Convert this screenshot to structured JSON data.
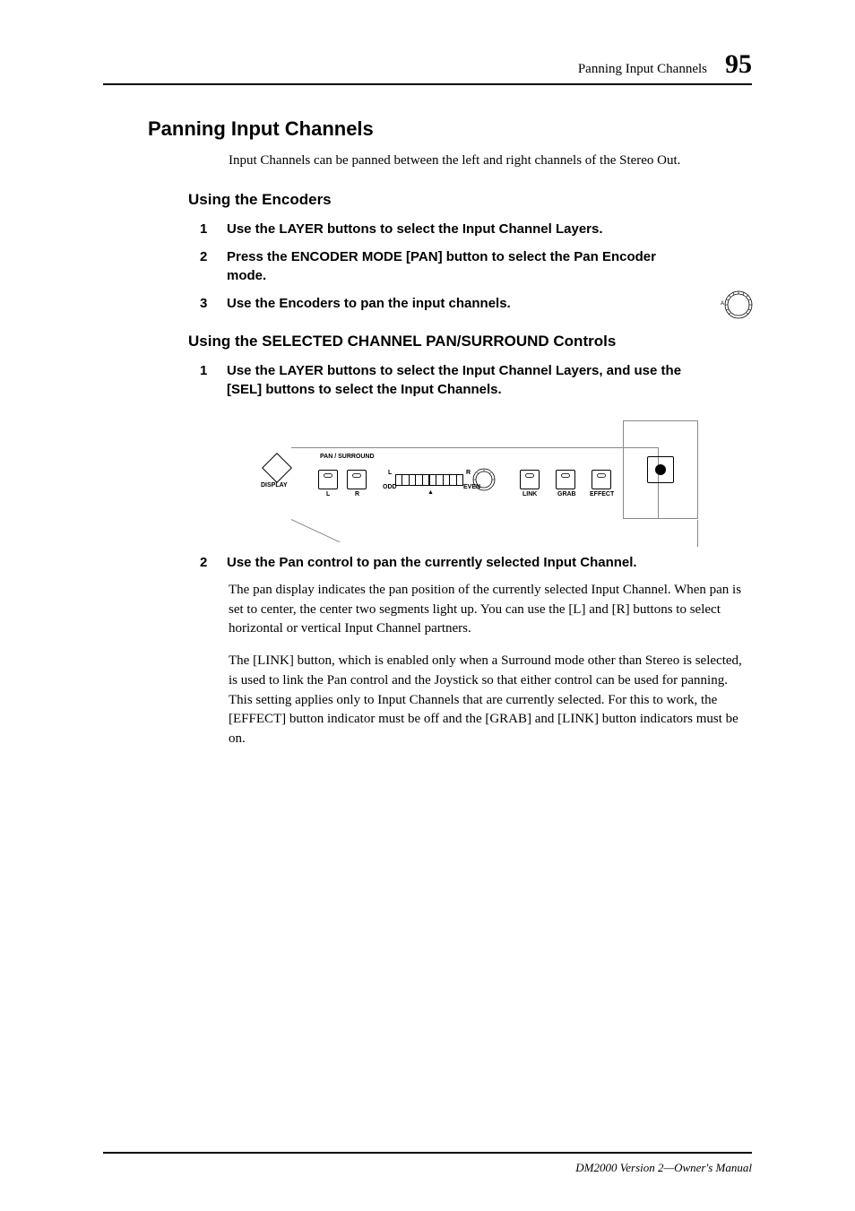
{
  "header": {
    "title": "Panning Input Channels",
    "page": "95"
  },
  "h1": "Panning Input Channels",
  "intro": "Input Channels can be panned between the left and right channels of the Stereo Out.",
  "section1": {
    "title": "Using the Encoders",
    "steps": [
      "Use the LAYER buttons to select the Input Channel Layers.",
      "Press the ENCODER MODE [PAN] button to select the Pan Encoder mode.",
      "Use the Encoders to pan the input channels."
    ]
  },
  "section2": {
    "title": "Using the SELECTED CHANNEL PAN/SURROUND Controls",
    "step1": "Use the LAYER buttons to select the Input Channel Layers, and use the [SEL] buttons to select the Input Channels.",
    "step2": "Use the Pan control to pan the currently selected Input Channel.",
    "body1": "The pan display indicates the pan position of the currently selected Input Channel. When pan is set to center, the center two segments light up. You can use the [L] and [R] buttons to select horizontal or vertical Input Channel partners.",
    "body2": "The [LINK] button, which is enabled only when a Surround mode other than Stereo is selected, is used to link the Pan control and the Joystick so that either control can be used for panning. This setting applies only to Input Channels that are currently selected. For this to work, the [EFFECT] button indicator must be off and the [GRAB] and [LINK] button indicators must be on."
  },
  "panel": {
    "title": "PAN / SURROUND",
    "display": "DISPLAY",
    "l": "L",
    "r": "R",
    "l_odd_label": "L",
    "odd": "ODD",
    "r_even_label": "R",
    "even": "EVEN",
    "arrows": "▲",
    "link": "LINK",
    "grab": "GRAB",
    "effect": "EFFECT"
  },
  "encoder_label": "A",
  "footer": "DM2000 Version 2—Owner's Manual",
  "chart_data": null
}
